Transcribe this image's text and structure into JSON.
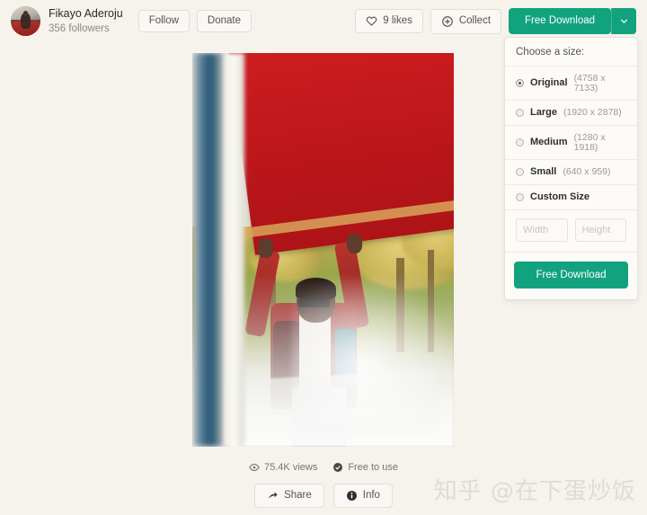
{
  "header": {
    "author_name": "Fikayo Aderoju",
    "followers": "356 followers",
    "follow_label": "Follow",
    "donate_label": "Donate",
    "likes_label": "9 likes",
    "collect_label": "Collect",
    "free_download_label": "Free Download"
  },
  "size_panel": {
    "title": "Choose a size:",
    "options": [
      {
        "label": "Original",
        "dims": "(4758 x 7133)",
        "selected": true
      },
      {
        "label": "Large",
        "dims": "(1920 x 2878)",
        "selected": false
      },
      {
        "label": "Medium",
        "dims": "(1280 x 1918)",
        "selected": false
      },
      {
        "label": "Small",
        "dims": "(640 x 959)",
        "selected": false
      },
      {
        "label": "Custom Size",
        "dims": "",
        "selected": false
      }
    ],
    "width_placeholder": "Width",
    "height_placeholder": "Height",
    "download_label": "Free Download"
  },
  "stats": {
    "views": "75.4K views",
    "license": "Free to use"
  },
  "bottom": {
    "share_label": "Share",
    "info_label": "Info"
  },
  "watermark": {
    "text": "知乎 @在下蛋炒饭"
  },
  "colors": {
    "accent_green": "#12a37e",
    "page_background": "#f6f3ed",
    "text_primary": "#2b2b2b",
    "text_muted": "#8a8a88"
  }
}
